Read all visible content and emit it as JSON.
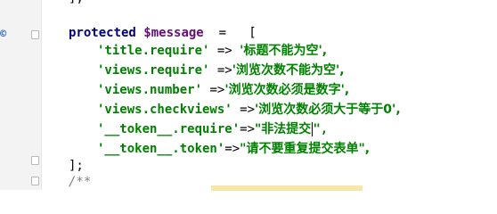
{
  "gutter": {
    "mark": "©"
  },
  "code": {
    "line0": "],",
    "l1_kw": "protected",
    "l1_var": "$message",
    "l1_rest": "  =   [",
    "l2_key": "'title.require'",
    "l2_arrow": " => ",
    "l2_val": "'标题不能为空',",
    "l3_key": "'views.require'",
    "l3_arrow": " =>",
    "l3_val": "'浏览次数不能为空',",
    "l4_key": "'views.number'",
    "l4_arrow": " =>",
    "l4_val": "'浏览次数必须是数字',",
    "l5_key": "'views.checkviews'",
    "l5_arrow": " =>",
    "l5_val": "'浏览次数必须大于等于0',",
    "l6_key": "'__token__.require'",
    "l6_arrow": "=>",
    "l6_val": "\"非法提交",
    "l6_tail": "\",",
    "l7_key": "'__token__.token'",
    "l7_arrow": "=>",
    "l7_val": "\"请不要重复提交表单\",",
    "l8": "];",
    "l9": "/**"
  }
}
